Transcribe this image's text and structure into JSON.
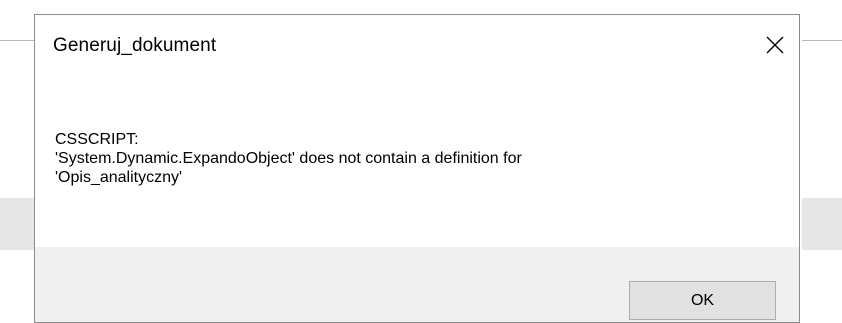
{
  "dialog": {
    "title": "Generuj_dokument",
    "close_icon": "close-icon",
    "message": "CSSCRIPT:\n'System.Dynamic.ExpandoObject' does not contain a definition for\n'Opis_analityczny'",
    "ok_label": "OK"
  },
  "colors": {
    "dialog_border": "#8c8c8c",
    "footer_bg": "#f0f0f0",
    "button_bg": "#e1e1e1",
    "button_border": "#adadad",
    "backdrop_band": "#e6e6e6"
  }
}
